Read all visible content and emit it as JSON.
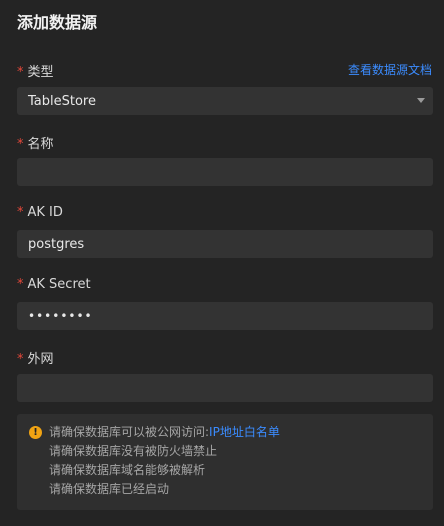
{
  "dialog": {
    "title": "添加数据源",
    "docs_link": "查看数据源文档"
  },
  "fields": {
    "type": {
      "required": "*",
      "label": "类型",
      "value": "TableStore"
    },
    "name": {
      "required": "*",
      "label": "名称",
      "value": ""
    },
    "ak_id": {
      "required": "*",
      "label": "AK ID",
      "value": "postgres"
    },
    "ak_secret": {
      "required": "*",
      "label": "AK Secret",
      "value": "••••••••"
    },
    "external": {
      "required": "*",
      "label": "外网",
      "value": ""
    }
  },
  "notice": {
    "icon": "info-icon",
    "icon_glyph": "!",
    "line1_text": "请确保数据库可以被公网访问:",
    "line1_link": "IP地址白名单",
    "line2": "请确保数据库没有被防火墙禁止",
    "line3": "请确保数据库域名能够被解析",
    "line4": "请确保数据库已经启动"
  },
  "colors": {
    "background": "#242424",
    "field": "#333333",
    "link": "#3b8cff",
    "required": "#e5483a",
    "warning": "#f0a313"
  }
}
